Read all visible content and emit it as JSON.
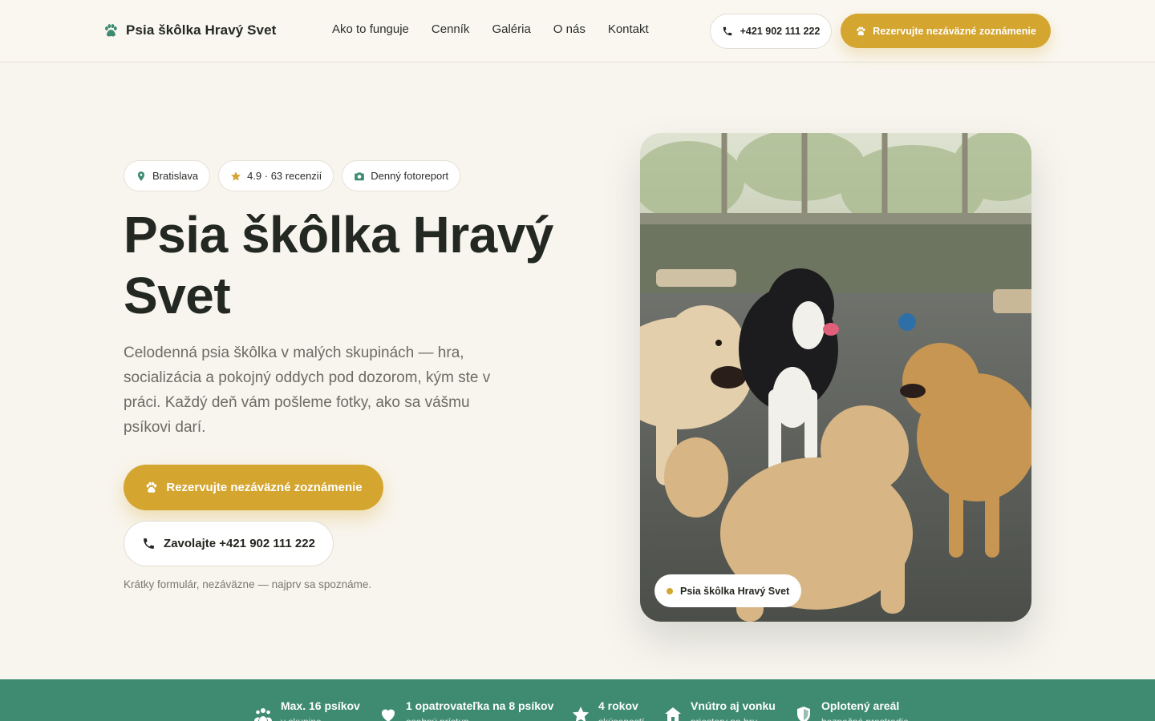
{
  "header": {
    "brand": "Psia škôlka Hravý Svet",
    "nav": [
      "Ako to funguje",
      "Cenník",
      "Galéria",
      "O nás",
      "Kontakt"
    ],
    "phone": "+421 902 111 222",
    "cta": "Rezervujte nezáväzné zoznámenie"
  },
  "hero": {
    "badges": [
      {
        "icon": "map-pin-icon",
        "label": "Bratislava"
      },
      {
        "icon": "star-icon",
        "label": "4.9 · 63 recenzií"
      },
      {
        "icon": "camera-icon",
        "label": "Denný fotoreport"
      }
    ],
    "title": "Psia škôlka Hravý Svet",
    "description": "Celodenná psia škôlka v malých skupinách — hra, socializácia a pokojný oddych pod dozorom, kým ste v práci. Každý deň vám pošleme fotky, ako sa vášmu psíkovi darí.",
    "cta_primary": "Rezervujte nezáväzné zoznámenie",
    "cta_call": "Zavolajte +421 902 111 222",
    "fine_print": "Krátky formulár, nezáväzne — najprv sa spoznáme.",
    "photo_caption": "Psia škôlka Hravý Svet"
  },
  "features": [
    {
      "icon": "group-icon",
      "title": "Max. 16 psíkov",
      "sub": "v skupine"
    },
    {
      "icon": "heart-icon",
      "title": "1 opatrovateľka na 8 psíkov",
      "sub": "osobný prístup"
    },
    {
      "icon": "star-icon",
      "title": "4 rokov",
      "sub": "skúseností"
    },
    {
      "icon": "house-icon",
      "title": "Vnútro aj vonku",
      "sub": "priestory na hru"
    },
    {
      "icon": "shield-icon",
      "title": "Oplotený areál",
      "sub": "bezpečné prostredie"
    }
  ],
  "colors": {
    "accent": "#d4a52f",
    "green": "#3e8b72",
    "background": "#f8f5ee",
    "text": "#232822"
  }
}
